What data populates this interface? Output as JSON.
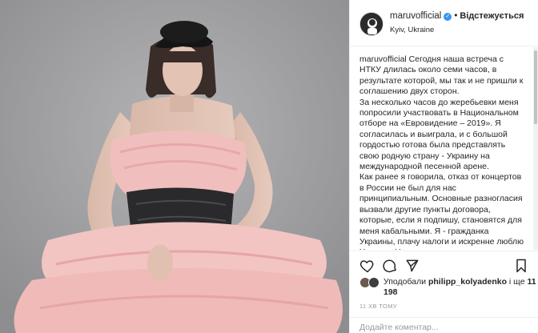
{
  "post": {
    "username": "maruvofficial",
    "verified_mark": "✓",
    "separator": "•",
    "follow_label": "Відстежується",
    "location": "Kyiv, Ukraine"
  },
  "caption": {
    "username": "maruvofficial",
    "paragraphs": [
      "Сегодня наша встреча с НТКУ длилась около семи часов, в результате которой, мы так и не пришли к соглашению двух сторон.",
      "За несколько часов до жеребьевки меня попросили участвовать в Национальном отборе на «Евровидение – 2019». Я согласилась и выиграла, и с большой гордостью готова была представлять свою родную страну - Украину на международной песенной арене.",
      "Как ранее я говорила, отказ от концертов в России не был для нас принципиальным. Основные разногласия вызвали другие пункты договора, которые, если я подпишу, становятся для меня кабальными. Я - гражданка Украины, плачу налоги и искренне люблю Украину. Но не готова"
    ]
  },
  "likes": {
    "prefix": "Уподобали ",
    "user": "philipp_kolyadenko",
    "middle": " і ще ",
    "count": "11 198"
  },
  "timestamp": "11 ХВ ТОМУ",
  "comment": {
    "placeholder": "Додайте коментар..."
  },
  "icons": [
    "heart-icon",
    "comment-icon",
    "share-icon",
    "bookmark-icon"
  ],
  "colors": {
    "verified": "#3897f0",
    "border": "#efefef",
    "muted": "#999999",
    "dress": "#f2c4c2"
  }
}
